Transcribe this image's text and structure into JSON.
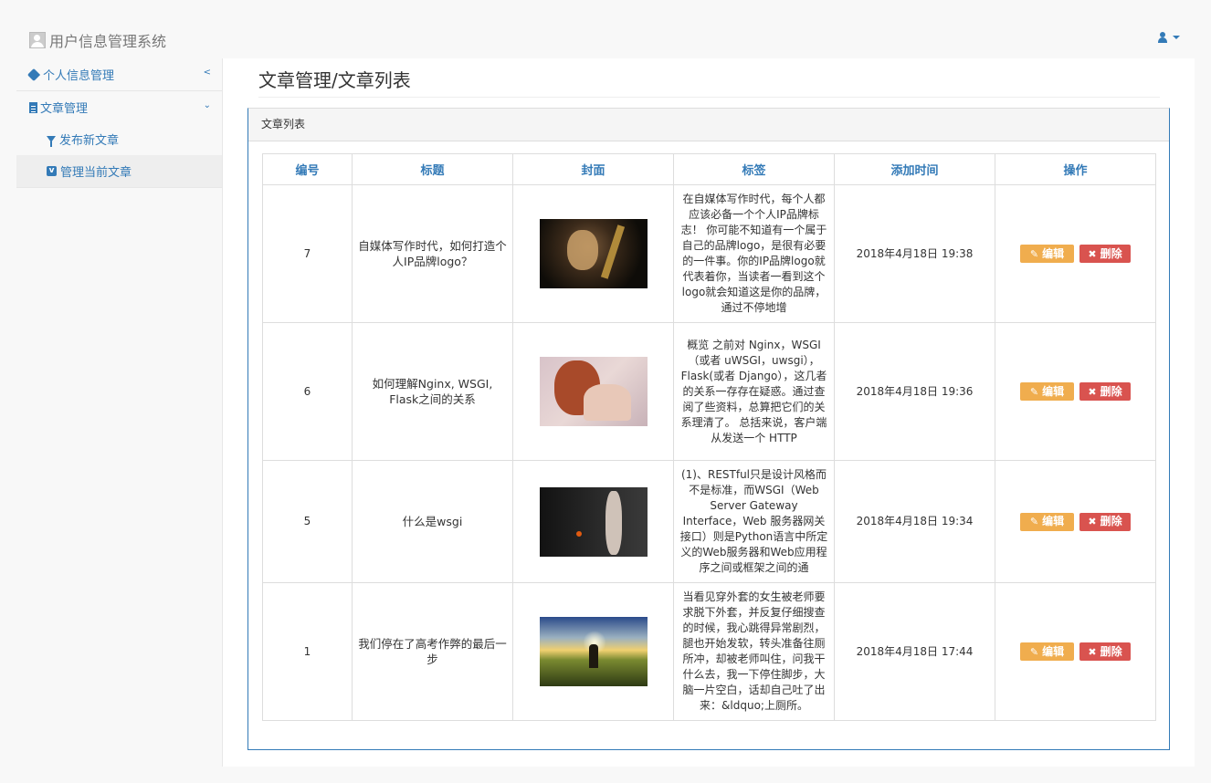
{
  "app": {
    "title": "用户信息管理系统"
  },
  "sidebar": {
    "items": [
      {
        "label": "个人信息管理"
      },
      {
        "label": "文章管理"
      }
    ],
    "sub_items": [
      {
        "label": "发布新文章"
      },
      {
        "label": "管理当前文章"
      }
    ]
  },
  "main": {
    "page_title": "文章管理/文章列表",
    "panel_title": "文章列表"
  },
  "table": {
    "headers": [
      "编号",
      "标题",
      "封面",
      "标签",
      "添加时间",
      "操作"
    ],
    "rows": [
      {
        "id": "7",
        "title": "自媒体写作时代，如何打造个人IP品牌logo？",
        "tag": "在自媒体写作时代，每个人都应该必备一个个人IP品牌标志！ 你可能不知道有一个属于自己的品牌logo，是很有必要的一件事。你的IP品牌logo就代表着你，当读者一看到这个logo就会知道这是你的品牌，通过不停地增",
        "time": "2018年4月18日 19:38",
        "edit": "编辑",
        "delete": "删除"
      },
      {
        "id": "6",
        "title": "如何理解Nginx, WSGI, Flask之间的关系",
        "tag": "概览 之前对 Nginx，WSGI（或者 uWSGI，uwsgi），Flask(或者 Django），这几者的关系一存存在疑惑。通过查阅了些资料，总算把它们的关系理清了。 总括来说，客户端从发送一个 HTTP",
        "time": "2018年4月18日 19:36",
        "edit": "编辑",
        "delete": "删除"
      },
      {
        "id": "5",
        "title": "什么是wsgi",
        "tag": "(1)、RESTful只是设计风格而不是标准，而WSGI（Web Server Gateway Interface，Web 服务器网关接口）则是Python语言中所定义的Web服务器和Web应用程序之间或框架之间的通",
        "time": "2018年4月18日 19:34",
        "edit": "编辑",
        "delete": "删除"
      },
      {
        "id": "1",
        "title": "我们停在了高考作弊的最后一步",
        "tag": "当看见穿外套的女生被老师要求脱下外套，并反复仔细搜查的时候，我心跳得异常剧烈，腿也开始发软，转头准备往厕所冲，却被老师叫住，问我干什么去，我一下停住脚步，大脑一片空白，话却自己吐了出来：&ldquo;上厕所。",
        "time": "2018年4月18日 17:44",
        "edit": "编辑",
        "delete": "删除"
      }
    ]
  },
  "colors": {
    "link": "#337ab7",
    "edit": "#f0ad4e",
    "delete": "#d9534f"
  },
  "icons": [
    "user-icon",
    "tag-icon",
    "file-icon",
    "filter-icon",
    "v-icon",
    "pencil-square-icon",
    "times-icon",
    "chevron-left-icon",
    "chevron-down-icon",
    "caret-down-icon"
  ]
}
